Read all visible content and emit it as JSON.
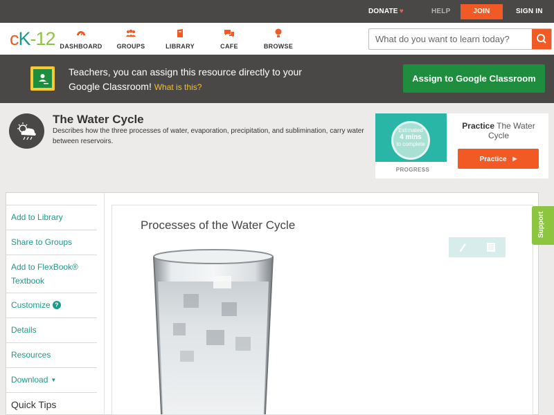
{
  "topbar": {
    "donate": "DONATE",
    "help": "HELP",
    "join": "JOIN",
    "signin": "SIGN IN"
  },
  "header": {
    "logo_c": "c",
    "logo_k": "K",
    "logo_dash": "-",
    "logo_12": "12",
    "nav": [
      {
        "label": "DASHBOARD",
        "icon": "dashboard-icon"
      },
      {
        "label": "GROUPS",
        "icon": "groups-icon"
      },
      {
        "label": "LIBRARY",
        "icon": "library-icon"
      },
      {
        "label": "CAFE",
        "icon": "cafe-icon"
      },
      {
        "label": "BROWSE",
        "icon": "browse-icon"
      }
    ],
    "search_placeholder": "What do you want to learn today?"
  },
  "banner": {
    "text": "Teachers, you can assign this resource directly to your Google Classroom!",
    "what": "What is this?",
    "button": "Assign to Google Classroom"
  },
  "concept": {
    "title": "The Water Cycle",
    "description": "Describes how the three processes of water, evaporation, precipitation, and sublimination, carry water between reservoirs."
  },
  "practice_card": {
    "estimated": "Estimated",
    "mins": "4 mins",
    "to_complete": "to complete",
    "progress": "PROGRESS",
    "title_bold": "Practice",
    "title_rest": "The Water Cycle",
    "button": "Practice"
  },
  "sidebar": {
    "items": [
      {
        "label": "Add to Library"
      },
      {
        "label": "Share to Groups"
      },
      {
        "label": "Add to FlexBook® Textbook"
      },
      {
        "label": "Customize"
      },
      {
        "label": "Details"
      },
      {
        "label": "Resources"
      },
      {
        "label": "Download"
      }
    ],
    "quick_tips": "Quick Tips"
  },
  "lesson": {
    "title": "Processes of the Water Cycle"
  },
  "support": "Support",
  "colors": {
    "brand_orange": "#f15a24",
    "brand_teal": "#1b9a89",
    "brand_green": "#8cc540",
    "google_green": "#1e8e3e",
    "dark_bar": "#4a4847"
  }
}
